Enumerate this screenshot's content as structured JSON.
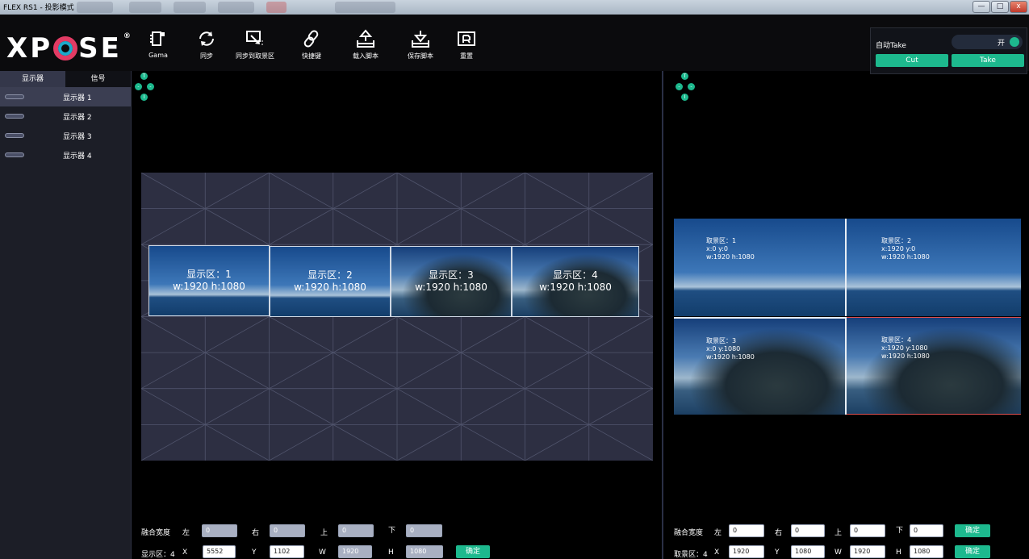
{
  "window": {
    "title": "FLEX RS1 - 投影模式",
    "minimize": "—",
    "restore": "□",
    "close": "x"
  },
  "logo": {
    "text_a": "X",
    "text_b": "P",
    "text_c": "SE",
    "reg": "®"
  },
  "toolbar": {
    "items": [
      {
        "label": "Gama",
        "icon": "gama-icon"
      },
      {
        "label": "同步",
        "icon": "sync-icon"
      },
      {
        "label": "同步到取景区",
        "icon": "sync-to-capture-icon"
      },
      {
        "label": "快捷键",
        "icon": "link-icon"
      },
      {
        "label": "载入脚本",
        "icon": "load-script-icon"
      },
      {
        "label": "保存脚本",
        "icon": "save-script-icon"
      },
      {
        "label": "重置",
        "icon": "reset-icon"
      }
    ]
  },
  "take_panel": {
    "auto_take_label": "自动Take",
    "toggle_text": "开",
    "cut_label": "Cut",
    "take_label": "Take"
  },
  "sidebar": {
    "tabs": [
      "显示器",
      "信号"
    ],
    "items": [
      "显示器 1",
      "显示器 2",
      "显示器 3",
      "显示器 4"
    ]
  },
  "left_canvas": {
    "zones": [
      {
        "name": "显示区：1",
        "size": "w:1920  h:1080"
      },
      {
        "name": "显示区：2",
        "size": "w:1920  h:1080"
      },
      {
        "name": "显示区：3",
        "size": "w:1920  h:1080"
      },
      {
        "name": "显示区：4",
        "size": "w:1920  h:1080"
      }
    ]
  },
  "right_canvas": {
    "zones": [
      {
        "name": "取景区：1",
        "pos": "x:0  y:0",
        "size": "w:1920  h:1080"
      },
      {
        "name": "取景区：2",
        "pos": "x:1920  y:0",
        "size": "w:1920  h:1080"
      },
      {
        "name": "取景区：3",
        "pos": "x:0  y:1080",
        "size": "w:1920  h:1080"
      },
      {
        "name": "取景区：4",
        "pos": "x:1920  y:1080",
        "size": "w:1920  h:1080"
      }
    ]
  },
  "dpad": {
    "up": "T",
    "down": "I",
    "left": "-",
    "right": "-"
  },
  "left_bottom": {
    "blend_label": "融合宽度",
    "left_label": "左",
    "left_value": "0",
    "right_label": "右",
    "right_value": "0",
    "top_label": "上",
    "top_value": "0",
    "bottom_label": "下",
    "bottom_value": "0",
    "zone_label": "显示区：4",
    "x_label": "X",
    "x_value": "5552",
    "y_label": "Y",
    "y_value": "1102",
    "w_label": "W",
    "w_value": "1920",
    "h_label": "H",
    "h_value": "1080",
    "confirm": "确定"
  },
  "right_bottom": {
    "blend_label": "融合宽度",
    "left_label": "左",
    "left_value": "0",
    "right_label": "右",
    "right_value": "0",
    "top_label": "上",
    "top_value": "0",
    "bottom_label": "下",
    "bottom_value": "0",
    "confirm_blend": "确定",
    "zone_label": "取景区：4",
    "x_label": "X",
    "x_value": "1920",
    "y_label": "Y",
    "y_value": "1080",
    "w_label": "W",
    "w_value": "1920",
    "h_label": "H",
    "h_value": "1080",
    "confirm": "确定"
  },
  "colors": {
    "accent": "#1db98e",
    "panel": "#1c1e27",
    "canvas": "#2d2f42"
  }
}
